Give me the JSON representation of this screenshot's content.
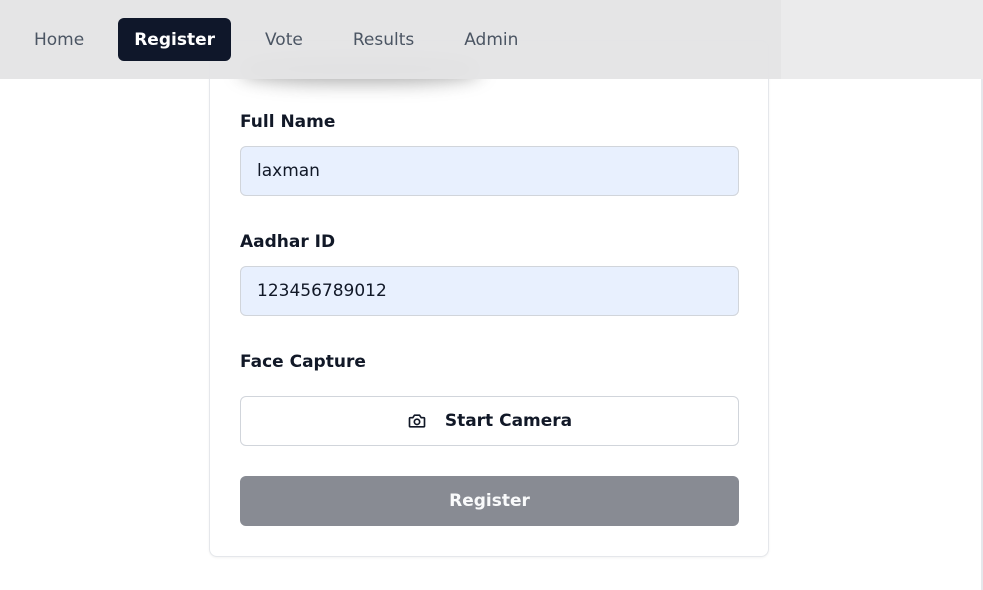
{
  "nav": {
    "items": [
      {
        "label": "Home",
        "active": false
      },
      {
        "label": "Register",
        "active": true
      },
      {
        "label": "Vote",
        "active": false
      },
      {
        "label": "Results",
        "active": false
      },
      {
        "label": "Admin",
        "active": false
      }
    ]
  },
  "form": {
    "full_name": {
      "label": "Full Name",
      "value": "laxman"
    },
    "aadhar_id": {
      "label": "Aadhar ID",
      "value": "123456789012"
    },
    "face_capture": {
      "label": "Face Capture",
      "button_label": "Start Camera",
      "icon": "camera-icon"
    },
    "submit_label": "Register"
  },
  "colors": {
    "active_nav_bg": "#0f172a",
    "input_autofill_bg": "#e8f0fe",
    "register_button_disabled": "#888b93",
    "navbar_bg": "#e4e4e5"
  }
}
